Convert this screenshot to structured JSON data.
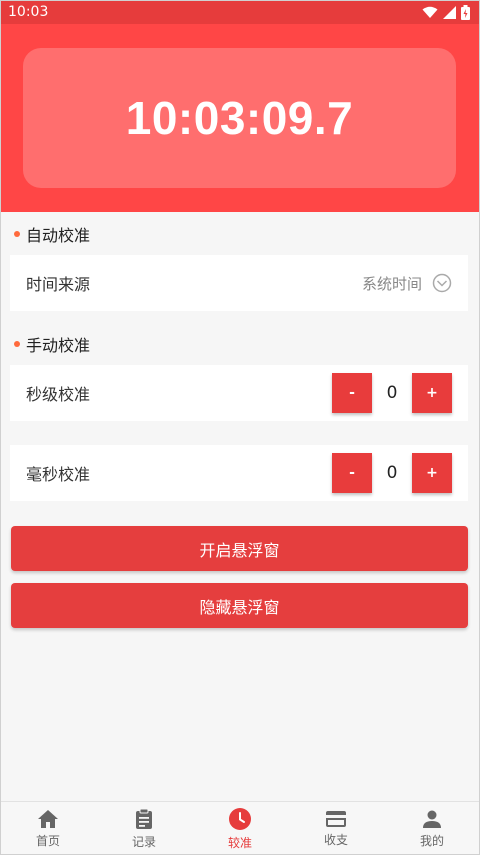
{
  "status_bar": {
    "time": "10:03"
  },
  "clock": {
    "time": "10:03:09.7"
  },
  "auto_calibration": {
    "title": "自动校准",
    "source_label": "时间来源",
    "source_value": "系统时间"
  },
  "manual_calibration": {
    "title": "手动校准",
    "seconds_label": "秒级校准",
    "seconds_value": "0",
    "millis_label": "毫秒校准",
    "millis_value": "0",
    "minus_label": "-",
    "plus_label": "+"
  },
  "actions": {
    "open_float": "开启悬浮窗",
    "hide_float": "隐藏悬浮窗"
  },
  "nav": {
    "items": [
      {
        "label": "首页",
        "icon": "home-icon"
      },
      {
        "label": "记录",
        "icon": "clipboard-icon"
      },
      {
        "label": "较准",
        "icon": "clock-icon",
        "active": true
      },
      {
        "label": "收支",
        "icon": "card-icon"
      },
      {
        "label": "我的",
        "icon": "person-icon"
      }
    ]
  },
  "colors": {
    "primary": "#ff4646",
    "status_bar": "#e63c3c",
    "button": "#e53e3e",
    "accent_dot": "#ff6a3d"
  }
}
